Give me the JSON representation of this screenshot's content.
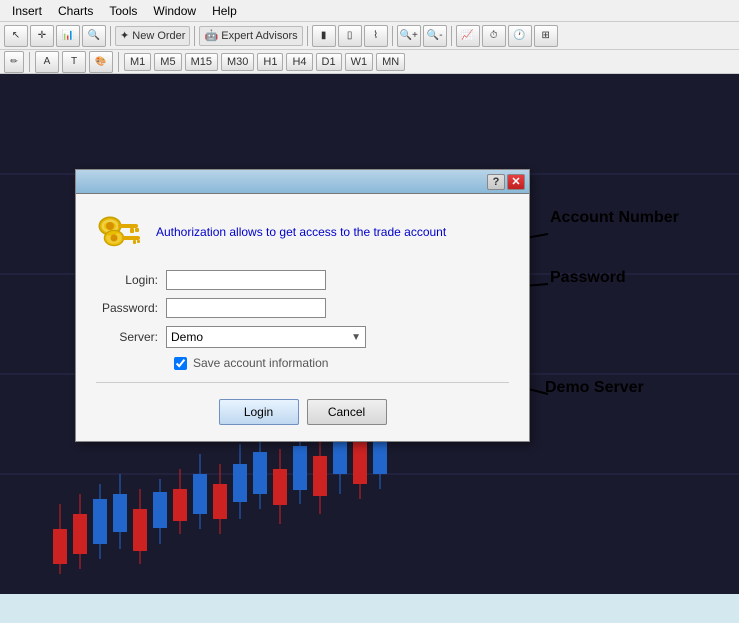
{
  "menu": {
    "items": [
      "Insert",
      "Charts",
      "Tools",
      "Window",
      "Help"
    ]
  },
  "toolbar": {
    "buttons": [
      "arrow",
      "zoom-in",
      "chart",
      "scroll",
      "new-order",
      "expert-advisors"
    ],
    "new_order_label": "New Order",
    "expert_advisors_label": "Expert Advisors",
    "timeframes": [
      "M1",
      "M5",
      "M15",
      "M30",
      "H1",
      "H4",
      "D1",
      "W1",
      "MN"
    ]
  },
  "dialog": {
    "title": "",
    "help_btn_label": "?",
    "close_btn_label": "✕",
    "message": "Authorization allows to get access to the trade account",
    "login_label": "Login:",
    "password_label": "Password:",
    "server_label": "Server:",
    "server_value": "Demo",
    "save_checkbox_label": "Save account information",
    "login_btn_label": "Login",
    "cancel_btn_label": "Cancel"
  },
  "annotations": {
    "account_number": "Account Number",
    "password": "Password",
    "demo_server": "Demo Server"
  }
}
